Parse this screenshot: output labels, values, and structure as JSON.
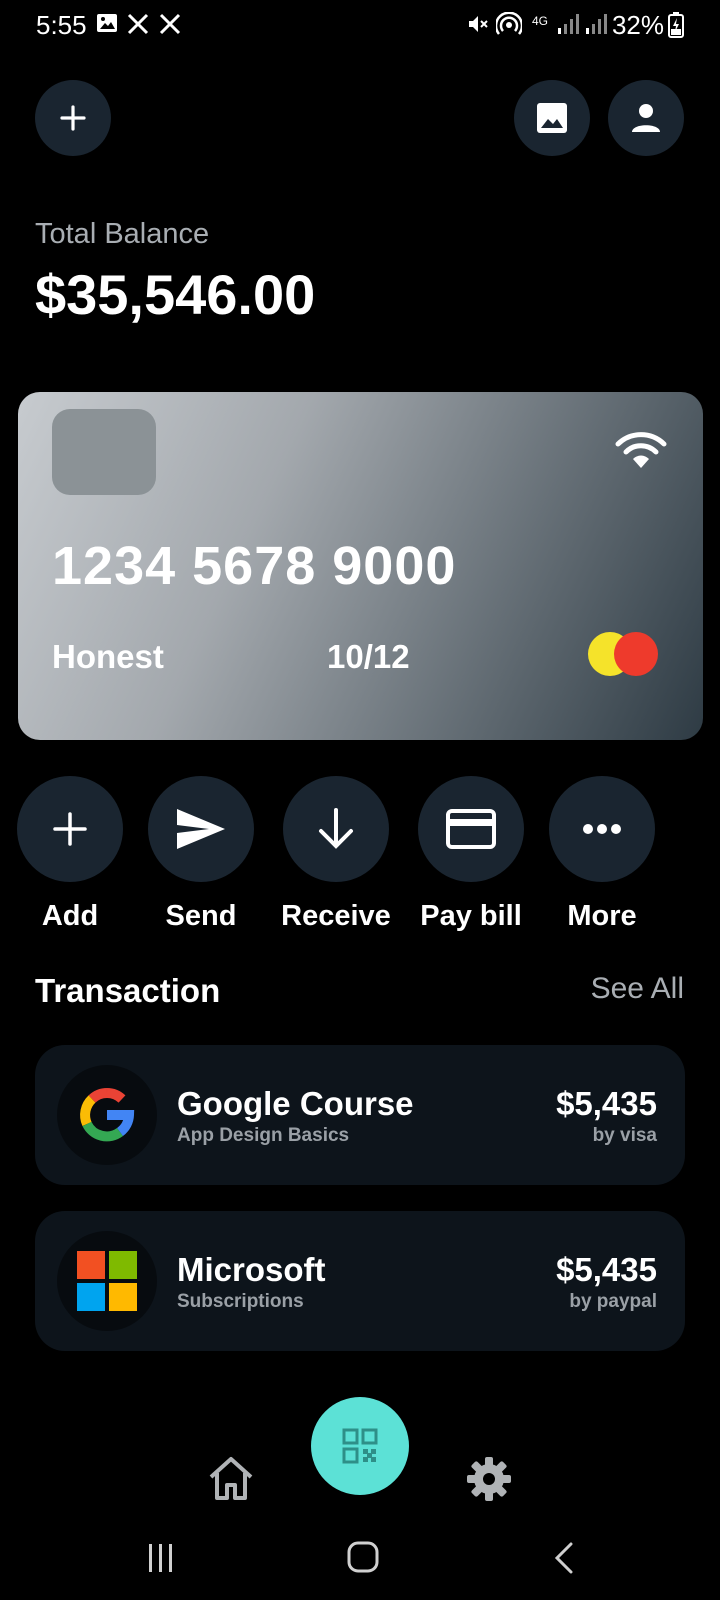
{
  "status_bar": {
    "time": "5:55",
    "battery": "32%",
    "network": "4G"
  },
  "header": {
    "add_button_icon": "plus-icon",
    "gallery_button_icon": "image-icon",
    "profile_button_icon": "person-icon"
  },
  "balance": {
    "label": "Total Balance",
    "value": "$35,546.00"
  },
  "card": {
    "number": "1234 5678 9000",
    "holder": "Honest",
    "expiry": "10/12",
    "contactless_icon": "wifi-icon",
    "brand_icon": "mastercard-icon"
  },
  "actions": [
    {
      "label": "Add",
      "icon": "plus-icon"
    },
    {
      "label": "Send",
      "icon": "send-icon"
    },
    {
      "label": "Receive",
      "icon": "arrow-down-icon"
    },
    {
      "label": "Pay bill",
      "icon": "credit-card-icon"
    },
    {
      "label": "More",
      "icon": "more-dots-icon"
    }
  ],
  "transactions": {
    "title": "Transaction",
    "see_all": "See All",
    "items": [
      {
        "name": "Google Course",
        "subtitle": "App Design Basics",
        "amount": "$5,435",
        "method": "by visa",
        "logo": "google-logo"
      },
      {
        "name": "Microsoft",
        "subtitle": "Subscriptions",
        "amount": "$5,435",
        "method": "by paypal",
        "logo": "microsoft-logo"
      }
    ]
  },
  "bottom_nav": {
    "home_icon": "home-icon",
    "scan_icon": "qr-code-icon",
    "settings_icon": "gear-icon"
  },
  "colors": {
    "background": "#000000",
    "surface": "#1a2530",
    "accent": "#5ce1d6",
    "muted_text": "#a9aeb3"
  }
}
